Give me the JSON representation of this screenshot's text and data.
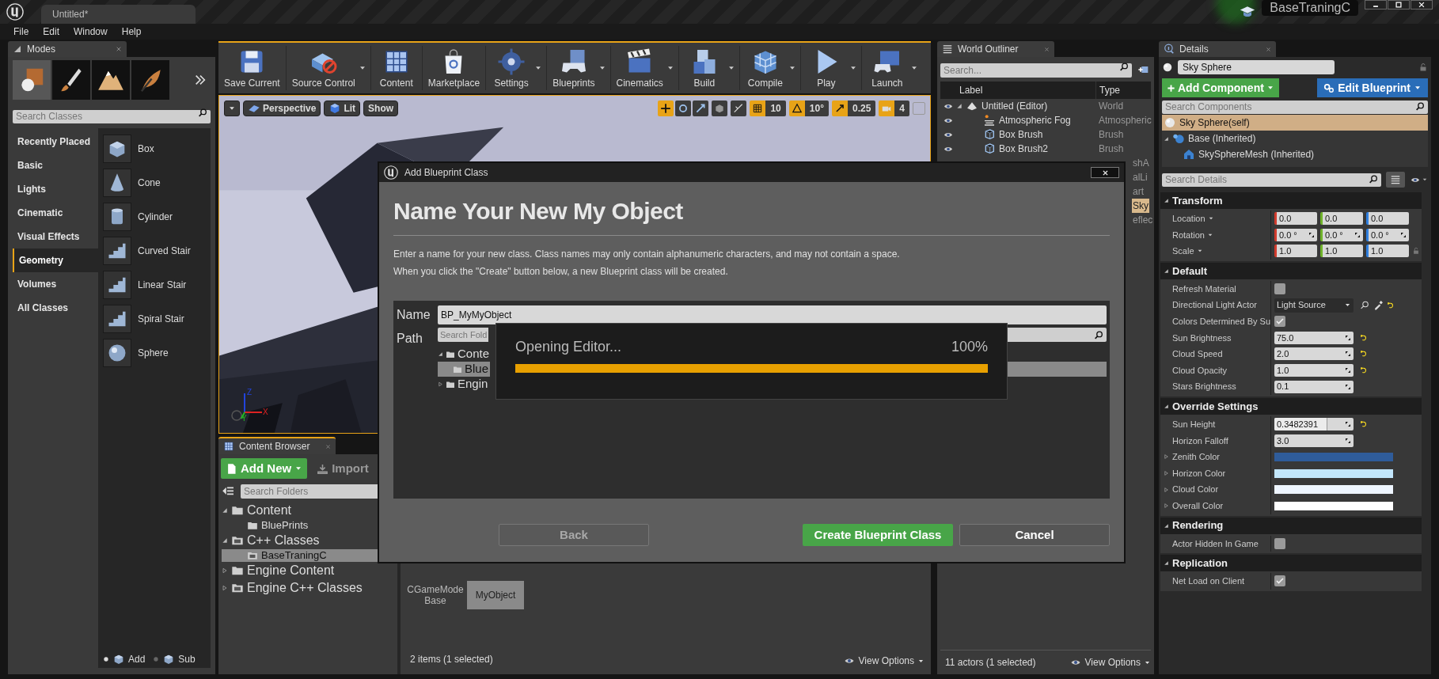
{
  "title_bar": {
    "tab": "Untitled*",
    "project": "BaseTraningC"
  },
  "menu": [
    "File",
    "Edit",
    "Window",
    "Help"
  ],
  "modes": {
    "tab": "Modes",
    "tab_selected": false,
    "search_placeholder": "Search Classes",
    "tools": [
      {
        "kind": "place",
        "selected": true
      },
      {
        "kind": "paint",
        "selected": false
      },
      {
        "kind": "landscape",
        "selected": false
      },
      {
        "kind": "foliage",
        "selected": false
      }
    ],
    "categories": [
      {
        "label": "Recently Placed",
        "selected": false
      },
      {
        "label": "Basic",
        "selected": false
      },
      {
        "label": "Lights",
        "selected": false
      },
      {
        "label": "Cinematic",
        "selected": false
      },
      {
        "label": "Visual Effects",
        "selected": false
      },
      {
        "label": "Geometry",
        "selected": true
      },
      {
        "label": "Volumes",
        "selected": false
      },
      {
        "label": "All Classes",
        "selected": false
      }
    ],
    "items": [
      {
        "label": "Box",
        "kind": "box"
      },
      {
        "label": "Cone",
        "kind": "cone"
      },
      {
        "label": "Cylinder",
        "kind": "cylinder"
      },
      {
        "label": "Curved Stair",
        "kind": "stair"
      },
      {
        "label": "Linear Stair",
        "kind": "stair"
      },
      {
        "label": "Spiral Stair",
        "kind": "stair"
      },
      {
        "label": "Sphere",
        "kind": "sphere"
      }
    ],
    "brush_modes": [
      {
        "label": "Add",
        "selected": true
      },
      {
        "label": "Sub",
        "selected": false
      }
    ]
  },
  "toolbar": [
    {
      "label": "Save Current",
      "kind": "save",
      "dropdown": false
    },
    {
      "label": "Source Control",
      "kind": "source",
      "dropdown": true
    },
    {
      "label": "Content",
      "kind": "content",
      "dropdown": false
    },
    {
      "label": "Marketplace",
      "kind": "market",
      "dropdown": false
    },
    {
      "label": "Settings",
      "kind": "settings",
      "dropdown": true
    },
    {
      "label": "Blueprints",
      "kind": "blueprints",
      "dropdown": true
    },
    {
      "label": "Cinematics",
      "kind": "cinematics",
      "dropdown": true
    },
    {
      "label": "Build",
      "kind": "build",
      "dropdown": true
    },
    {
      "label": "Compile",
      "kind": "compile",
      "dropdown": true
    },
    {
      "label": "Play",
      "kind": "play",
      "dropdown": true
    },
    {
      "label": "Launch",
      "kind": "launch",
      "dropdown": true
    }
  ],
  "viewport": {
    "buttons": [
      {
        "label": "Perspective",
        "kind": "perspective"
      },
      {
        "label": "Lit",
        "kind": "lit"
      },
      {
        "label": "Show",
        "kind": "plain"
      }
    ],
    "snaps": [
      {
        "value": "10",
        "kind": "grid"
      },
      {
        "value": "10°",
        "kind": "rotate"
      },
      {
        "value": "0.25",
        "kind": "scale"
      },
      {
        "value": "4",
        "kind": "camera"
      }
    ],
    "gizmo_labels": [
      "Z",
      "X",
      "Y"
    ]
  },
  "content_browser": {
    "tab": "Content Browser",
    "tab_selected": true,
    "add_new": "Add New",
    "import": "Import",
    "search_placeholder": "Search Folders",
    "tree": [
      {
        "label": "Content",
        "kind": "folder",
        "expanded": true,
        "selected": false,
        "children": [
          {
            "label": "BluePrints",
            "kind": "folder",
            "selected": false
          }
        ]
      },
      {
        "label": "C++ Classes",
        "kind": "cpp",
        "expanded": true,
        "selected": false,
        "children": [
          {
            "label": "BaseTraningC",
            "kind": "cpp",
            "selected": true
          }
        ]
      },
      {
        "label": "Engine Content",
        "kind": "folder",
        "expanded": false,
        "selected": false
      },
      {
        "label": "Engine C++ Classes",
        "kind": "cpp",
        "expanded": false,
        "selected": false
      }
    ],
    "assets": [
      {
        "label": "CGameMode Base",
        "selected": false
      },
      {
        "label": "MyObject",
        "selected": true
      }
    ],
    "status": "2 items (1 selected)",
    "view_options": "View Options"
  },
  "world_outliner": {
    "tab": "World Outliner",
    "tab_selected": false,
    "search_placeholder": "Search...",
    "columns": [
      "Label",
      "Type"
    ],
    "rows": [
      {
        "label": "Untitled (Editor)",
        "type": "World",
        "kind": "world",
        "expanded": true,
        "visible": true,
        "children": [
          {
            "label": "Atmospheric Fog",
            "type": "Atmospheric",
            "kind": "fog",
            "visible": true
          },
          {
            "label": "Box Brush",
            "type": "Brush",
            "kind": "brush",
            "visible": true
          },
          {
            "label": "Box Brush2",
            "type": "Brush",
            "kind": "brush",
            "visible": true
          }
        ]
      }
    ],
    "covered_rows": [
      {
        "text": "shA",
        "selected": false
      },
      {
        "text": "alLi",
        "selected": false
      },
      {
        "text": "art",
        "selected": false
      },
      {
        "text": "Sky",
        "selected": true
      },
      {
        "text": "eflec",
        "selected": false
      }
    ],
    "status": "11 actors (1 selected)",
    "view_options": "View Options"
  },
  "details": {
    "tab": "Details",
    "tab_selected": false,
    "actor_name": "Sky Sphere",
    "add_component": "Add Component",
    "edit_blueprint": "Edit Blueprint",
    "search_components_placeholder": "Search Components",
    "components": [
      {
        "label": "Sky Sphere(self)",
        "kind": "sphere",
        "selected": true
      },
      {
        "label": "Base (Inherited)",
        "kind": "scene",
        "selected": false,
        "children": [
          {
            "label": "SkySphereMesh (Inherited)",
            "kind": "mesh",
            "selected": false
          }
        ]
      }
    ],
    "search_details_placeholder": "Search Details",
    "sections": [
      {
        "title": "Transform",
        "props": [
          {
            "label": "Location",
            "kind": "vector",
            "values": [
              "0.0",
              "0.0",
              "0.0"
            ]
          },
          {
            "label": "Rotation",
            "kind": "rotator",
            "values": [
              "0.0 °",
              "0.0 °",
              "0.0 °"
            ]
          },
          {
            "label": "Scale",
            "kind": "vector",
            "values": [
              "1.0",
              "1.0",
              "1.0"
            ],
            "lock": true
          }
        ]
      },
      {
        "title": "Default",
        "props": [
          {
            "label": "Refresh Material",
            "kind": "checkbox",
            "checked": false
          },
          {
            "label": "Directional Light Actor",
            "kind": "dropdown",
            "value": "Light Source"
          },
          {
            "label": "Colors Determined By Su",
            "kind": "checkbox",
            "checked": true
          },
          {
            "label": "Sun Brightness",
            "kind": "number",
            "value": "75.0",
            "reset": true
          },
          {
            "label": "Cloud Speed",
            "kind": "number",
            "value": "2.0",
            "reset": true
          },
          {
            "label": "Cloud Opacity",
            "kind": "number",
            "value": "1.0",
            "reset": true
          },
          {
            "label": "Stars Brightness",
            "kind": "number",
            "value": "0.1",
            "reset": false
          }
        ]
      },
      {
        "title": "Override Settings",
        "props": [
          {
            "label": "Sun Height",
            "kind": "slider",
            "value": "0.3482391",
            "level": 0.67,
            "reset": true
          },
          {
            "label": "Horizon Falloff",
            "kind": "number",
            "value": "3.0",
            "reset": false
          },
          {
            "label": "Zenith Color",
            "kind": "color",
            "color": "#2f5c9a"
          },
          {
            "label": "Horizon Color",
            "kind": "color",
            "color": "#c2e6fb"
          },
          {
            "label": "Cloud Color",
            "kind": "color",
            "color": "#eef5ff"
          },
          {
            "label": "Overall Color",
            "kind": "color",
            "color": "#ffffff"
          }
        ]
      },
      {
        "title": "Rendering",
        "props": [
          {
            "label": "Actor Hidden In Game",
            "kind": "checkbox",
            "checked": false
          }
        ]
      },
      {
        "title": "Replication",
        "props": [
          {
            "label": "Net Load on Client",
            "kind": "checkbox",
            "checked": true
          }
        ]
      }
    ]
  },
  "dialog": {
    "title": "Add Blueprint Class",
    "heading": "Name Your New My Object",
    "description": [
      "Enter a name for your new class. Class names may only contain alphanumeric characters, and may not contain a space.",
      "When you click the \"Create\" button below, a new Blueprint class will be created."
    ],
    "name_label": "Name",
    "name_value": "BP_MyMyObject",
    "path_label": "Path",
    "path_placeholder": "Search Fold",
    "path_tree": [
      {
        "label": "Conte",
        "expanded": true,
        "selected": false,
        "children": [
          {
            "label": "Blue",
            "selected": true
          }
        ]
      },
      {
        "label": "Engin",
        "expanded": false,
        "selected": false
      }
    ],
    "buttons": [
      {
        "label": "Back",
        "kind": "back",
        "disabled": true
      },
      {
        "label": "Create Blueprint Class",
        "kind": "primary",
        "disabled": false
      },
      {
        "label": "Cancel",
        "kind": "secondary",
        "disabled": false
      }
    ]
  },
  "progress": {
    "label": "Opening Editor...",
    "percent": "100%",
    "level": 1
  }
}
